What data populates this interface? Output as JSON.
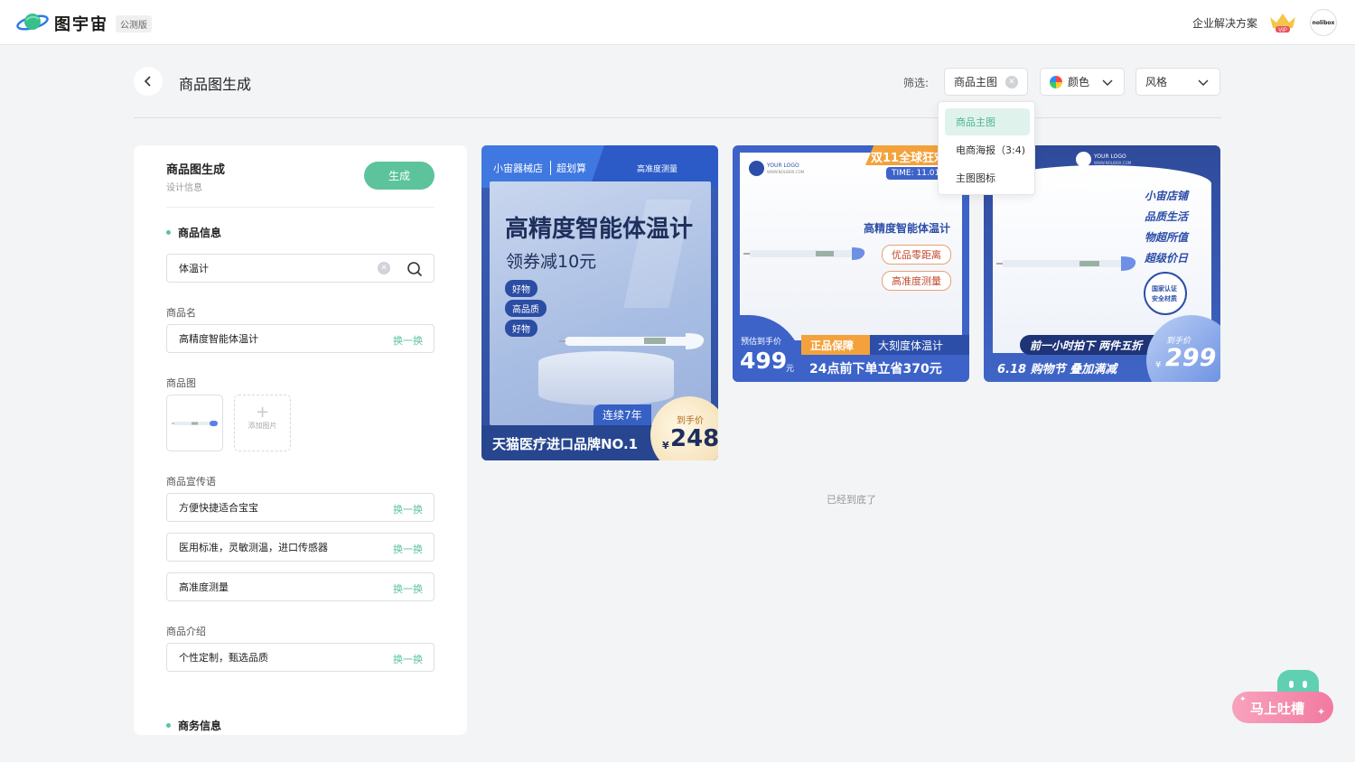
{
  "header": {
    "brand": "图宇宙",
    "beta": "公测版",
    "enterprise": "企业解决方案",
    "vip": "VIP",
    "avatar": "nolibox"
  },
  "page": {
    "title": "商品图生成",
    "filter_label": "筛选:"
  },
  "filters": {
    "type_value": "商品主图",
    "color_label": "颜色",
    "style_label": "风格",
    "dropdown": [
      "商品主图",
      "电商海报（3:4)",
      "主图图标"
    ]
  },
  "panel": {
    "title": "商品图生成",
    "subtitle": "设计信息",
    "generate": "生成",
    "section_product": "商品信息",
    "search_value": "体温计",
    "name_label": "商品名",
    "name_value": "高精度智能体温计",
    "swap": "换一换",
    "image_label": "商品图",
    "add_image": "添加图片",
    "slogan_label": "商品宣传语",
    "slogans": [
      "方便快捷适合宝宝",
      "医用标准，灵敏测温，进口传感器",
      "高准度测量"
    ],
    "intro_label": "商品介绍",
    "intro_value": "个性定制，甄选品质",
    "section_business": "商务信息"
  },
  "card1": {
    "shop": "小宙器械店",
    "tag": "超划算",
    "badge": "高准度测量",
    "headline": "高精度智能体温计",
    "sub": "领券减10元",
    "chips": [
      "好物",
      "高品质",
      "好物"
    ],
    "years": "连续7年",
    "bottom": "天猫医疗进口品牌NO.1",
    "price_label": "到手价",
    "currency": "¥",
    "price": "248"
  },
  "card2": {
    "logo": "YOUR LOGO",
    "logo_url": "WWW.NOLIBOX.COM",
    "festival": "双11全球狂欢",
    "time": "TIME: 11.01",
    "name": "高精度智能体温计",
    "pills": [
      "优品零距离",
      "高准度测量"
    ],
    "price_label": "预估到手价",
    "price": "499",
    "unit": "元",
    "guarantee": "正品保障",
    "tagline": "大刻度体温计",
    "promo": "24点前下单立省370元"
  },
  "card3": {
    "logo": "YOUR LOGO",
    "logo_url": "WWW.NOLIBOX.COM",
    "lines": [
      "小宙店铺",
      "品质生活",
      "物超所值",
      "超级价日"
    ],
    "seal1": "国家认证",
    "seal2": "安全材质",
    "promo": "前一小时拍下 两件五折",
    "event": "6.18 购物节  叠加满减",
    "price_label": "到手价",
    "currency": "¥",
    "price": "299"
  },
  "feed": {
    "end": "已经到底了"
  },
  "chat": {
    "label": "马上吐槽"
  }
}
